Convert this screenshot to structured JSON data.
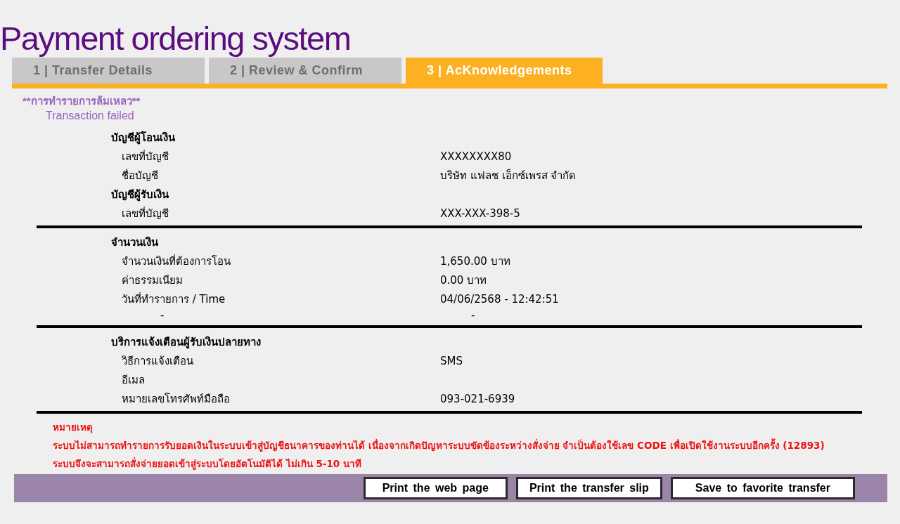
{
  "title": "Payment ordering system",
  "tabs": [
    {
      "label": "1 | Transfer Details",
      "selected": false
    },
    {
      "label": "2 | Review & Confirm",
      "selected": false
    },
    {
      "label": "3 | AcKnowledgements",
      "selected": true
    }
  ],
  "status": {
    "thai": "**การทำรายการล้มเหลว**",
    "english": "Transaction failed"
  },
  "sections": [
    {
      "rows": [
        {
          "kind": "heading",
          "label": "บัญชีผู้โอนเงิน"
        },
        {
          "kind": "field",
          "label": "เลขที่บัญชี",
          "value": "XXXXXXXX80"
        },
        {
          "kind": "field",
          "label": "ชื่อบัญชี",
          "value": "บริษัท แฟลช เอ็กซ์เพรส จำกัด"
        },
        {
          "kind": "heading",
          "label": "บัญชีผู้รับเงิน"
        },
        {
          "kind": "field",
          "label": "เลขที่บัญชี",
          "value": "XXX-XXX-398-5"
        }
      ]
    },
    {
      "rows": [
        {
          "kind": "heading",
          "label": "จำนวนเงิน"
        },
        {
          "kind": "field",
          "label": "จำนวนเงินที่ต้องการโอน",
          "value": "1,650.00 บาท"
        },
        {
          "kind": "field",
          "label": "ค่าธรรมเนียม",
          "value": "0.00 บาท"
        },
        {
          "kind": "field",
          "label": "วันที่ทำรายการ / Time",
          "value": "04/06/2568 - 12:42:51"
        },
        {
          "kind": "dash",
          "label": "-",
          "value": "-"
        }
      ]
    },
    {
      "rows": [
        {
          "kind": "heading",
          "label": "บริการแจ้งเตือนผู้รับเงินปลายทาง"
        },
        {
          "kind": "field",
          "label": "วิธีการแจ้งเตือน",
          "value": "SMS"
        },
        {
          "kind": "field",
          "label": "อีเมล"
        },
        {
          "kind": "field",
          "label": "หมายเลขโทรศัพท์มือถือ",
          "value": "093-021-6939"
        }
      ]
    }
  ],
  "note": {
    "heading": "หมายเหตุ",
    "text": "ระบบไม่สามารถทำรายการรับยอดเงินในระบบเข้าสู่บัญชีธนาคารของท่านได้ เนื่องจากเกิดปัญหาระบบขัดข้องระหว่างสั่งจ่าย จำเป็นต้องใช้เลข CODE เพื่อเปิดใช้งานระบบอีกครั้ง (12893) ระบบจึงจะสามารถสั่งจ่ายยอดเข้าสู่ระบบโดยอัตโนมัติได้ ไม่เกิน 5-10 นาที"
  },
  "buttons": [
    "Print the web page",
    "Print the transfer slip",
    "Save to favorite transfer"
  ]
}
